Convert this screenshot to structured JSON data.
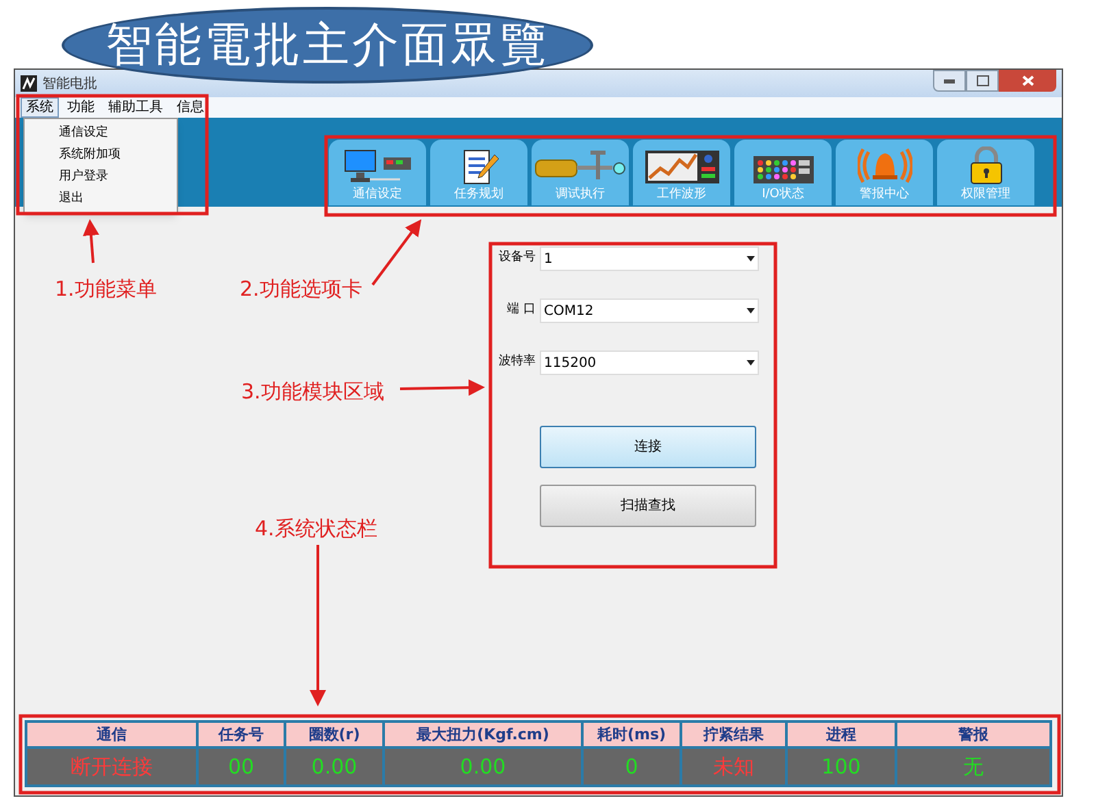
{
  "banner": {
    "title": "智能電批主介面眾覽"
  },
  "window": {
    "title": "智能电批"
  },
  "menu_bar": [
    {
      "label": "系统",
      "selected": true
    },
    {
      "label": "功能",
      "selected": false
    },
    {
      "label": "辅助工具",
      "selected": false
    },
    {
      "label": "信息",
      "selected": false
    }
  ],
  "dropdown": {
    "items": [
      "通信设定",
      "系统附加项",
      "用户登录",
      "退出"
    ]
  },
  "tabs": [
    {
      "label": "通信设定",
      "kind": "monitor"
    },
    {
      "label": "任务规划",
      "kind": "document"
    },
    {
      "label": "调试执行",
      "kind": "screwdriver"
    },
    {
      "label": "工作波形",
      "kind": "chart"
    },
    {
      "label": "I/O状态",
      "kind": "panel"
    },
    {
      "label": "警报中心",
      "kind": "alarm"
    },
    {
      "label": "权限管理",
      "kind": "lock"
    }
  ],
  "form": {
    "fields": [
      {
        "label": "设备号",
        "value": "1"
      },
      {
        "label": "端 口",
        "value": "COM12"
      },
      {
        "label": "波特率",
        "value": "115200"
      }
    ],
    "buttons": [
      {
        "label": "连接",
        "kind": "primary"
      },
      {
        "label": "扫描查找",
        "kind": "default"
      }
    ]
  },
  "status_bar": {
    "columns": [
      "通信",
      "任务号",
      "圈数(r)",
      "最大扭力(Kgf.cm)",
      "耗时(ms)",
      "拧紧结果",
      "进程",
      "警报"
    ],
    "values": [
      {
        "text": "断开连接",
        "color": "#ff3a3a"
      },
      {
        "text": "00",
        "color": "#22dd22"
      },
      {
        "text": "0.00",
        "color": "#22dd22"
      },
      {
        "text": "0.00",
        "color": "#22dd22"
      },
      {
        "text": "0",
        "color": "#22dd22"
      },
      {
        "text": "未知",
        "color": "#ff3a3a"
      },
      {
        "text": "100",
        "color": "#22dd22"
      },
      {
        "text": "无",
        "color": "#22dd22"
      }
    ]
  },
  "annotations": [
    "1.功能菜单",
    "2.功能选项卡",
    "3.功能模块区域",
    "4.系统状态栏"
  ]
}
